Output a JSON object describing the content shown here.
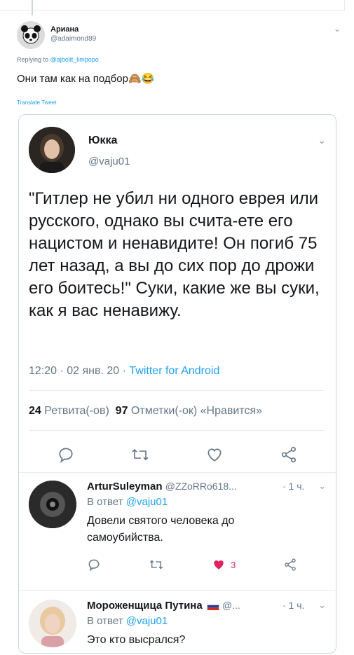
{
  "outer_tweet": {
    "author_name": "Ариана",
    "author_handle": "@adaimond89",
    "replying_label": "Replying to",
    "replying_to": "@ajbolit_limpopo",
    "text": "Они там как на подбор🙈😂",
    "translate": "Translate Tweet"
  },
  "quoted_tweet": {
    "author_name": "Юкка",
    "author_handle": "@vaju01",
    "text": "\"Гитлер не убил ни одного еврея или русского, однако вы счита-ете его нацистом и ненавидите! Он погиб 75 лет назад, а вы до сих пор до дрожи его боитесь!\" Суки, какие же вы суки, как я вас ненавижу.",
    "timestamp": "12:20 · 02 янв. 20 · ",
    "source": "Twitter for Android",
    "retweets_count": "24",
    "retweets_label": "Ретвита(-ов)",
    "likes_count": "97",
    "likes_label": "Отметки(-ок) «Нравится»"
  },
  "replies": [
    {
      "author_name": "ArturSuleyman",
      "author_handle": "@ZZoRRo618...",
      "time": "· 1 ч.",
      "reply_label": "В ответ",
      "reply_to": "@vaju01",
      "text": "Довели святого человека до самоубийства.",
      "like_count": "3"
    },
    {
      "author_name": "Мороженщица Путина",
      "author_handle": "@...",
      "time": "· 1 ч.",
      "reply_label": "В ответ",
      "reply_to": "@vaju01",
      "text": "Это кто высрался?"
    }
  ],
  "colors": {
    "accent": "#1da1f2",
    "muted": "#657786",
    "like": "#e0245e"
  }
}
